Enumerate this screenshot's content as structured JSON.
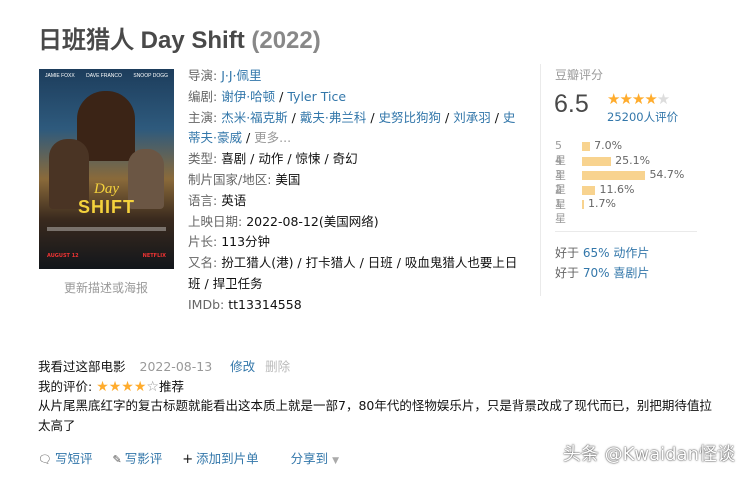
{
  "title": {
    "name": "日班猎人 Day Shift",
    "year": "(2022)"
  },
  "poster": {
    "cast_names": [
      "JAMIE FOXX",
      "DAVE FRANCO",
      "SNOOP DOGG"
    ],
    "logo_line1": "Day",
    "logo_line2": "SHIFT",
    "release": "AUGUST 12",
    "platform": "NETFLIX",
    "link": "更新描述或海报"
  },
  "info": {
    "director_label": "导演:",
    "director": "J·J·佩里",
    "writer_label": "编剧:",
    "writers": [
      "谢伊·哈顿",
      "Tyler Tice"
    ],
    "cast_label": "主演:",
    "cast": [
      "杰米·福克斯",
      "戴夫·弗兰科",
      "史努比狗狗",
      "刘承羽",
      "史蒂夫·豪威"
    ],
    "cast_more": "更多...",
    "genre_label": "类型:",
    "genres": "喜剧 / 动作 / 惊悚 / 奇幻",
    "country_label": "制片国家/地区:",
    "country": "美国",
    "language_label": "语言:",
    "language": "英语",
    "release_label": "上映日期:",
    "release": "2022-08-12(美国网络)",
    "runtime_label": "片长:",
    "runtime": "113分钟",
    "aka_label": "又名:",
    "aka": "扮工猎人(港) / 打卡猎人 / 日班 / 吸血鬼猎人也要上日班 / 捍卫任务",
    "imdb_label": "IMDb:",
    "imdb": "tt13314558"
  },
  "rating": {
    "label": "豆瓣评分",
    "score": "6.5",
    "stars_value": 3.5,
    "count": "25200人评价",
    "distribution": [
      {
        "star": "5星",
        "percent": "7.0%",
        "value": 7.0
      },
      {
        "star": "4星",
        "percent": "25.1%",
        "value": 25.1
      },
      {
        "star": "3星",
        "percent": "54.7%",
        "value": 54.7
      },
      {
        "star": "2星",
        "percent": "11.6%",
        "value": 11.6
      },
      {
        "star": "1星",
        "percent": "1.7%",
        "value": 1.7
      }
    ],
    "better_than": [
      {
        "prefix": "好于",
        "percent": "65%",
        "genre": "动作片"
      },
      {
        "prefix": "好于",
        "percent": "70%",
        "genre": "喜剧片"
      }
    ]
  },
  "my": {
    "watched": "我看过这部电影",
    "date": "2022-08-13",
    "edit": "修改",
    "delete": "删除",
    "rating_label": "我的评价:",
    "my_stars": 4,
    "rating_word": "推荐",
    "comment": "从片尾黑底红字的复古标题就能看出这本质上就是一部7，80年代的怪物娱乐片，只是背景改成了现代而已，别把期待值拉太高了"
  },
  "actions": {
    "short_review": "写短评",
    "review": "写影评",
    "add_list": "添加到片单",
    "share": "分享到"
  },
  "watermark": "头条 @Kwaidan怪谈"
}
